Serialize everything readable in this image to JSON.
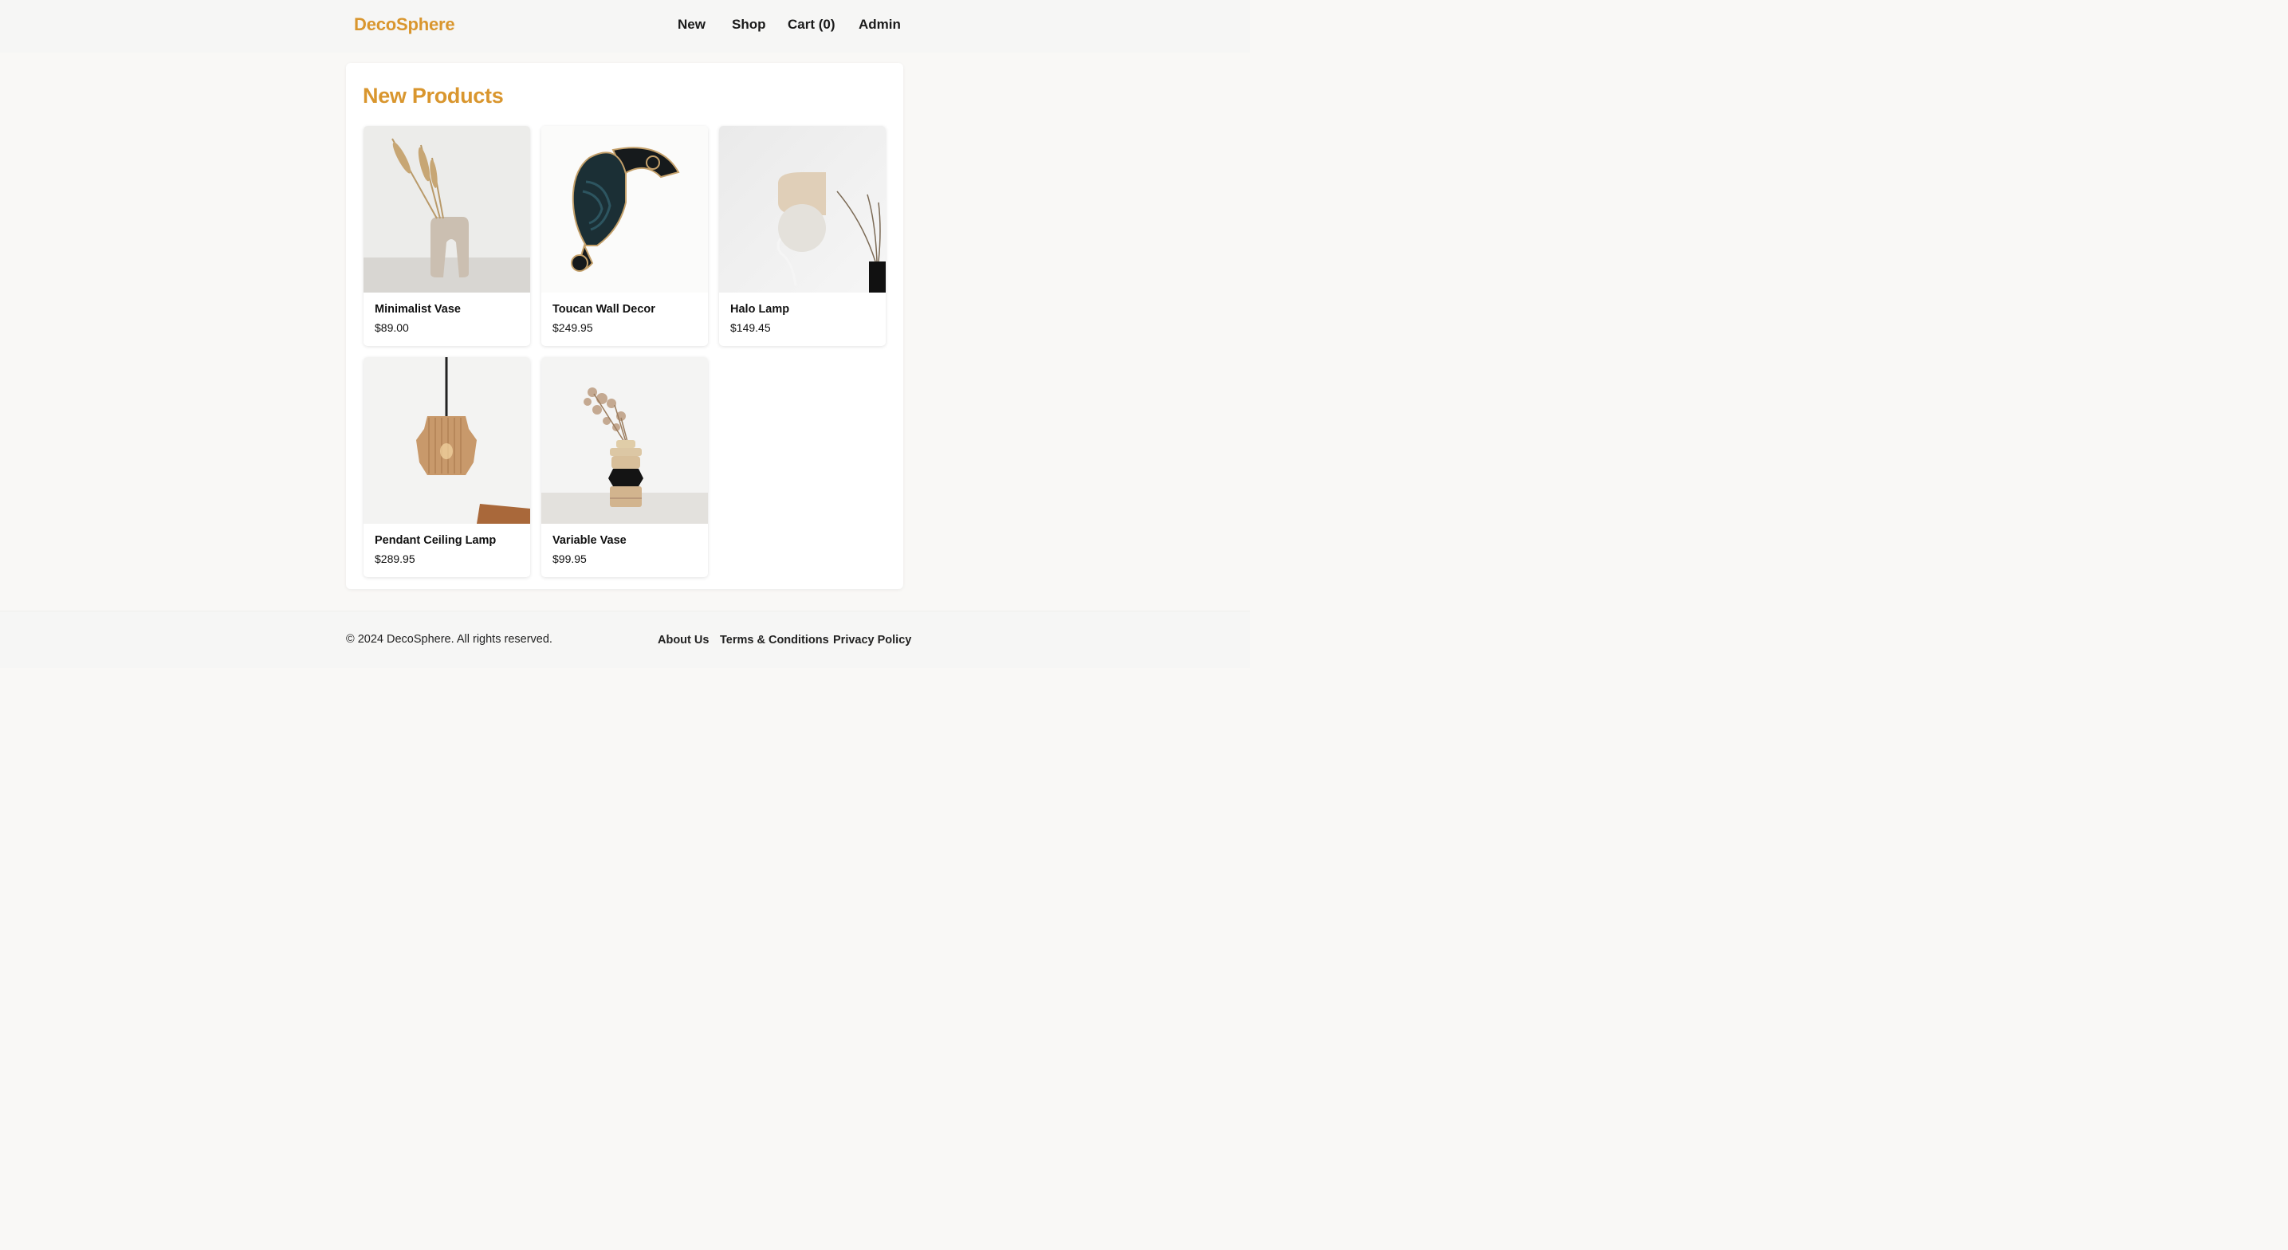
{
  "header": {
    "logo": "DecoSphere",
    "nav": [
      "New",
      "Shop",
      "Cart (0)",
      "Admin"
    ]
  },
  "main": {
    "title": "New Products",
    "products": [
      {
        "name": "Minimalist Vase",
        "price": "$89.00",
        "image": "minimalist-vase-photo"
      },
      {
        "name": "Toucan Wall Decor",
        "price": "$249.95",
        "image": "toucan-wall-decor-photo"
      },
      {
        "name": "Halo Lamp",
        "price": "$149.45",
        "image": "halo-lamp-photo"
      },
      {
        "name": "Pendant Ceiling Lamp",
        "price": "$289.95",
        "image": "pendant-ceiling-lamp-photo"
      },
      {
        "name": "Variable Vase",
        "price": "$99.95",
        "image": "variable-vase-photo"
      }
    ]
  },
  "footer": {
    "copyright": "© 2024 DecoSphere. All rights reserved.",
    "links": [
      "About Us",
      "Terms & Conditions",
      "Privacy Policy"
    ]
  },
  "colors": {
    "accent": "#d9962e",
    "background": "#f9f8f6",
    "header_bg": "#f6f6f5",
    "panel_bg": "#ffffff"
  }
}
